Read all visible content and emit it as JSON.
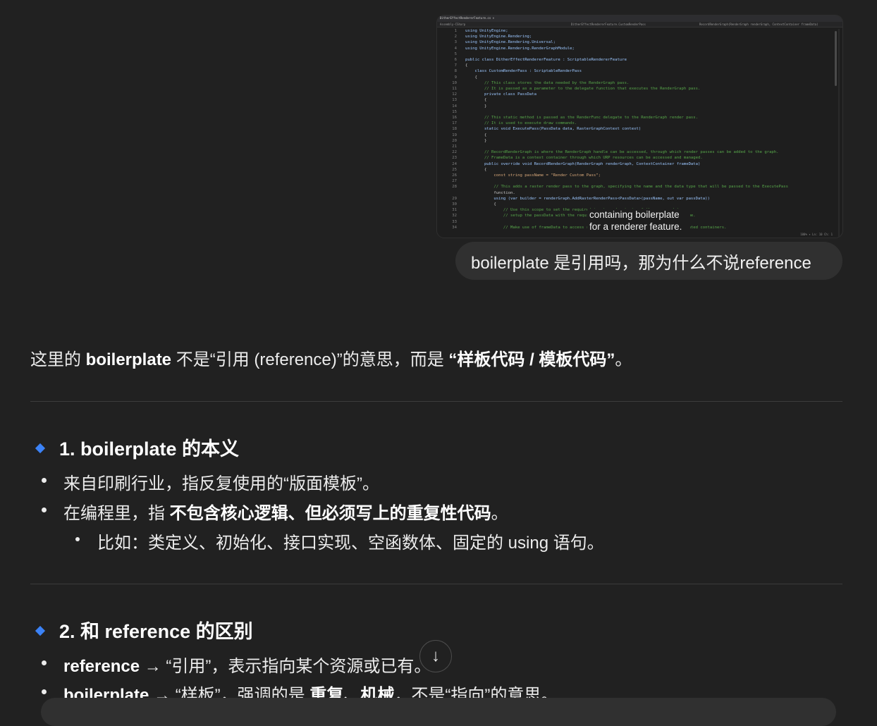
{
  "attachment": {
    "tab_title": "DitherEffectRendererFeature.cs ×",
    "nav_left": "Assembly-CSharp",
    "nav_mid": "DitherEffectRendererFeature.CustomRenderPass",
    "nav_right": "RecordRenderGraph(RenderGraph renderGraph, ContextContainer frameData)",
    "status": "100% ▾  Ln: 10  Ch: 1",
    "line_numbers": [
      "1",
      "2",
      "3",
      "4",
      "5",
      "6",
      "7",
      "8",
      "9",
      "10",
      "11",
      "12",
      "13",
      "14",
      "15",
      "16",
      "17",
      "18",
      "19",
      "20",
      "21",
      "22",
      "23",
      "24",
      "25",
      "26",
      "27",
      "28",
      "",
      "29",
      "30",
      "31",
      "32",
      "33",
      "34"
    ],
    "lines": [
      "using UnityEngine;",
      "using UnityEngine.Rendering;",
      "using UnityEngine.Rendering.Universal;",
      "using UnityEngine.Rendering.RenderGraphModule;",
      "",
      "public class DitherEffectRendererFeature : ScriptableRendererFeature",
      "{",
      "    class CustomRenderPass : ScriptableRenderPass",
      "    {",
      "        // This class stores the data needed by the RenderGraph pass.",
      "        // It is passed as a parameter to the delegate function that executes the RenderGraph pass.",
      "        private class PassData",
      "        {",
      "        }",
      "",
      "        // This static method is passed as the RenderFunc delegate to the RenderGraph render pass.",
      "        // It is used to execute draw commands.",
      "        static void ExecutePass(PassData data, RasterGraphContext context)",
      "        {",
      "        }",
      "",
      "        // RecordRenderGraph is where the RenderGraph handle can be accessed, through which render passes can be added to the graph.",
      "        // FrameData is a context container through which URP resources can be accessed and managed.",
      "        public override void RecordRenderGraph(RenderGraph renderGraph, ContextContainer frameData)",
      "        {",
      "            const string passName = \"Render Custom Pass\";",
      "",
      "            // This adds a raster render pass to the graph, specifying the name and the data type that will be passed to the ExecutePass",
      "            function.",
      "            using (var builder = renderGraph.AddRasterRenderPass<PassData>(passName, out var passData))",
      "            {",
      "                // Use this scope to set the required inputs and outputs of the pass and to",
      "                // setup the passData with the required properties needed at pass execution time.",
      "",
      "                // Make use of frameData to access resources and camera data through the dedicated containers."
    ],
    "tooltip_line1": "containing boilerplate",
    "tooltip_line2": "for a renderer feature."
  },
  "user_message": "boilerplate 是引用吗，那为什么不说reference",
  "answer": {
    "intro_a": "这里的 ",
    "intro_b": "boilerplate",
    "intro_c": " 不是“引用 (reference)”的意思，而是 ",
    "intro_d": "“样板代码 / 模板代码”",
    "intro_e": "。",
    "s1_heading": "1. boilerplate 的本义",
    "s1_b1": "来自印刷行业，指反复使用的“版面模板”。",
    "s1_b2_a": "在编程里，指 ",
    "s1_b2_b": "不包含核心逻辑、但必须写上的重复性代码",
    "s1_b2_c": "。",
    "s1_sub": "比如：类定义、初始化、接口实现、空函数体、固定的 using 语句。",
    "s2_heading": "2. 和 reference 的区别",
    "s2_b1_a": "reference",
    "s2_b1_b": " → “引用”，表示指向某个资源或已有",
    "s2_b1_c": "。",
    "s2_b2_a": "boilerplate",
    "s2_b2_b": " → “样板”，强调的是 ",
    "s2_b2_c": "重复、机械",
    "s2_b2_d": "，不是“指向”的意思。"
  },
  "colors": {
    "accent": "#3b82f6",
    "background": "#212121",
    "bubble": "#303030"
  }
}
